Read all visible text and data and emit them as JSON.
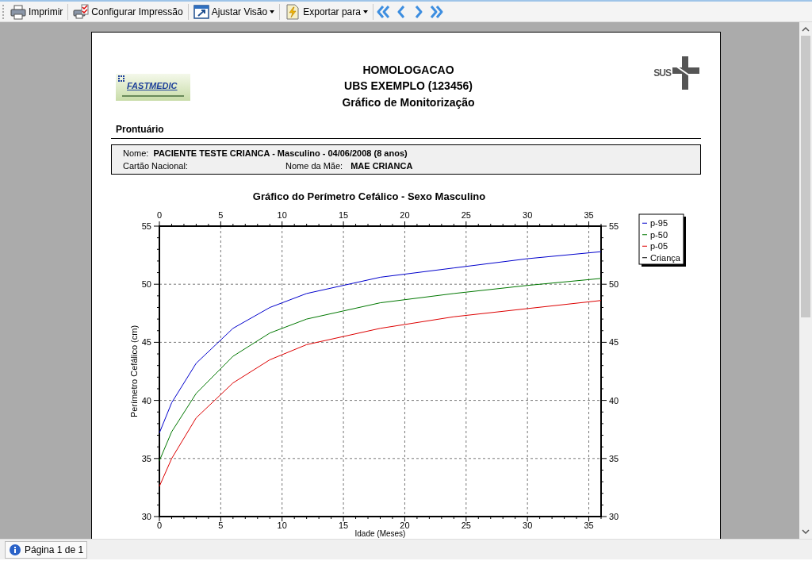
{
  "toolbar": {
    "buttons": [
      {
        "kind": "print",
        "label": "Imprimir",
        "dropdown": false
      },
      {
        "kind": "setup",
        "label": "Configurar Impressão",
        "dropdown": false
      },
      {
        "kind": "view",
        "label": "Ajustar Visão",
        "dropdown": true
      },
      {
        "kind": "export",
        "label": "Exportar para",
        "dropdown": true
      }
    ],
    "nav": [
      {
        "kind": "first"
      },
      {
        "kind": "prev"
      },
      {
        "kind": "next"
      },
      {
        "kind": "last"
      }
    ]
  },
  "report": {
    "logo_left": "FASTMEDIC",
    "logo_right": "SUS",
    "titles": [
      "HOMOLOGACAO",
      "UBS EXEMPLO (123456)",
      "Gráfico de Monitorização"
    ],
    "section": "Prontuário",
    "patient": {
      "name_label": "Nome:",
      "name": "PACIENTE TESTE CRIANCA - Masculino - 04/06/2008 (8 anos)",
      "card_label": "Cartão Nacional:",
      "mother_label": "Nome da Mãe:",
      "mother": "MAE CRIANCA"
    },
    "chart_data": {
      "type": "line",
      "title": "Gráfico do Perímetro Cefálico - Sexo Masculino",
      "xlabel": "Idade (Meses)",
      "ylabel": "Perímetro Cefálico (cm)",
      "x": [
        0,
        1,
        3,
        6,
        9,
        12,
        18,
        24,
        30,
        36
      ],
      "xlim": [
        0,
        36
      ],
      "ylim": [
        30,
        55
      ],
      "xticks": [
        0,
        5,
        10,
        15,
        20,
        25,
        30,
        35
      ],
      "yticks": [
        30,
        35,
        40,
        45,
        50,
        55
      ],
      "x2ticks": [
        0,
        5,
        10,
        15,
        20,
        25,
        30,
        35
      ],
      "y2ticks": [
        30,
        35,
        40,
        45,
        50,
        55
      ],
      "x2lim": [
        0,
        36
      ],
      "y2lim": [
        30,
        55
      ],
      "grid": true,
      "legend": true,
      "series": [
        {
          "name": "p-95",
          "color": "#0000cc",
          "values": [
            37.2,
            39.8,
            43.2,
            46.2,
            48.0,
            49.2,
            50.6,
            51.4,
            52.2,
            52.8
          ]
        },
        {
          "name": "p-50",
          "color": "#007700",
          "values": [
            34.8,
            37.3,
            40.6,
            43.8,
            45.8,
            47.0,
            48.4,
            49.2,
            49.9,
            50.5
          ]
        },
        {
          "name": "p-05",
          "color": "#dd0000",
          "values": [
            32.6,
            35.0,
            38.5,
            41.5,
            43.5,
            44.8,
            46.2,
            47.2,
            47.9,
            48.6
          ]
        },
        {
          "name": "Criança",
          "color": "#000000",
          "values": [
            null,
            null,
            null,
            null,
            null,
            null,
            null,
            null,
            null,
            null
          ]
        }
      ]
    }
  },
  "status_bar": {
    "page": "Página 1 de 1"
  }
}
